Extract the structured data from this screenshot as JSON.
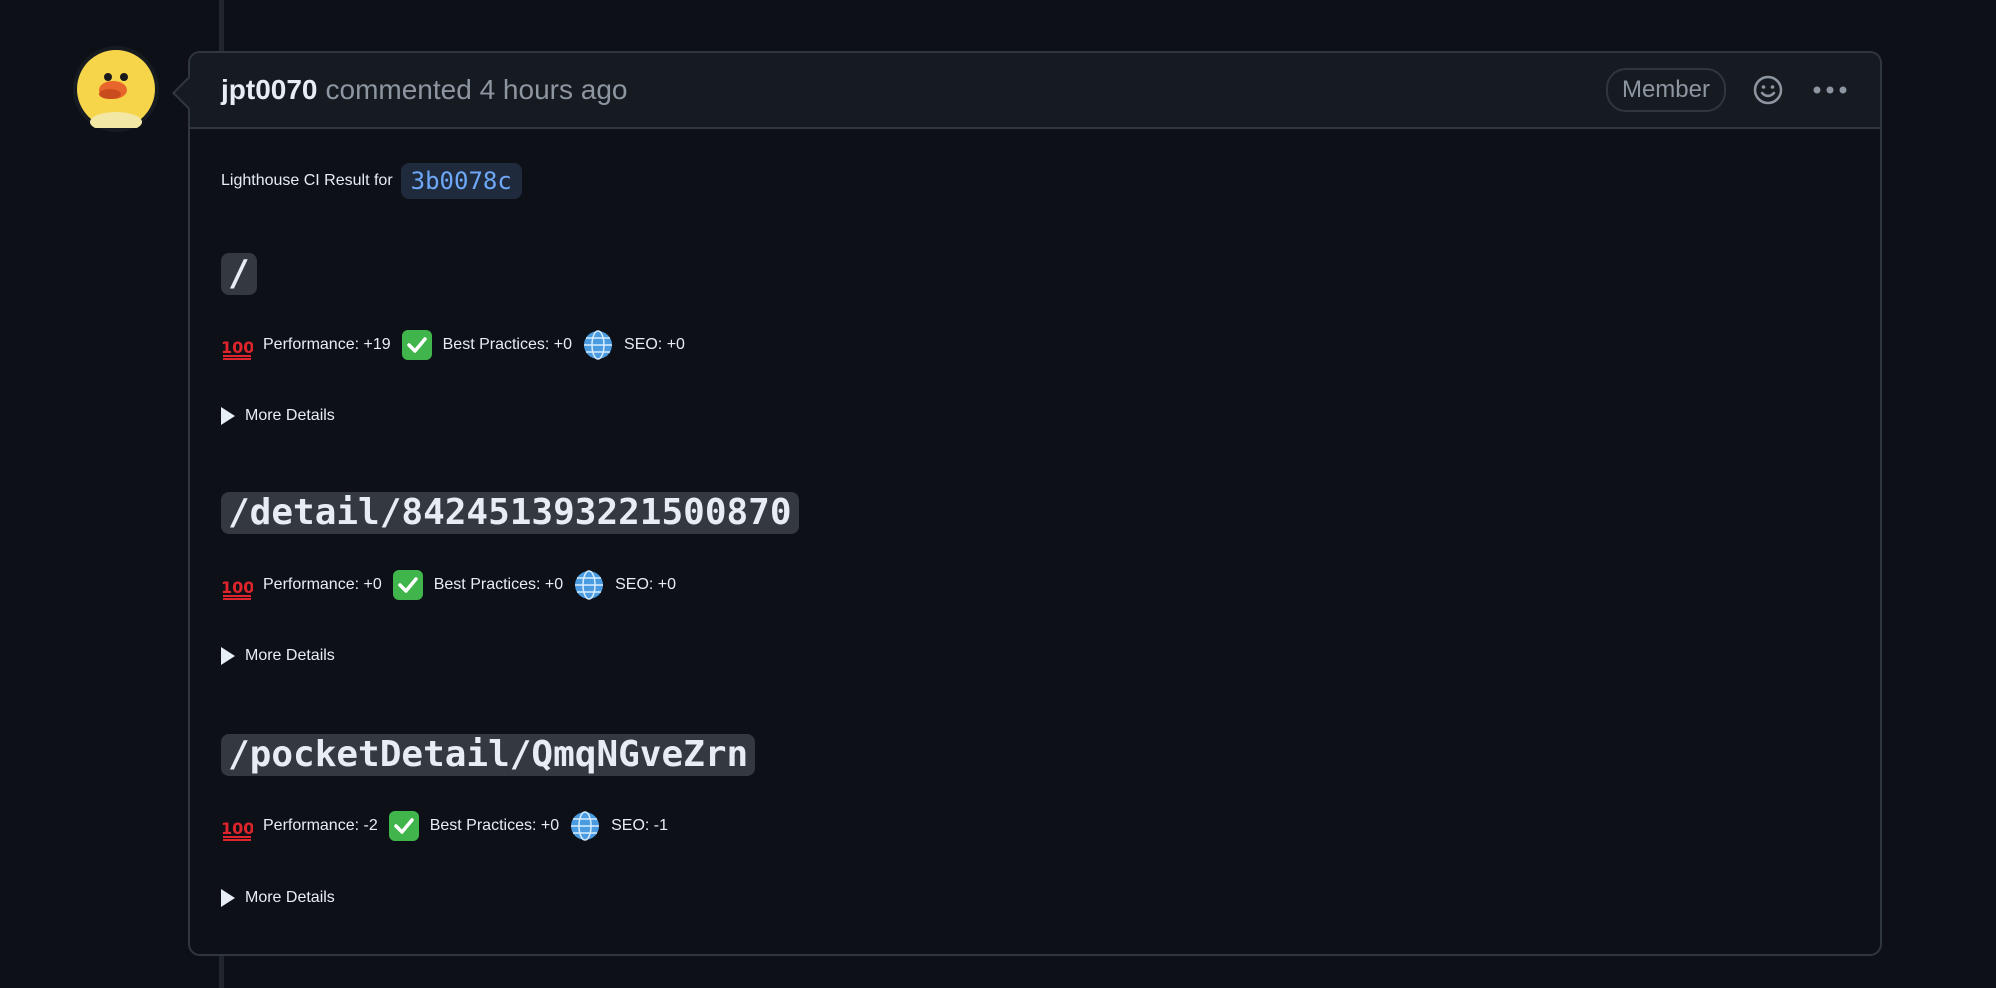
{
  "comment": {
    "author": "jpt0070",
    "meta": "commented 4 hours ago",
    "badge": "Member",
    "intro_text": "Lighthouse CI Result for",
    "commit": "3b0078c"
  },
  "routes": [
    {
      "path": "/",
      "performance": "Performance: +19",
      "best_practices": "Best Practices: +0",
      "seo": "SEO: +0",
      "details_label": "More Details"
    },
    {
      "path": "/detail/842451393221500870",
      "performance": "Performance: +0",
      "best_practices": "Best Practices: +0",
      "seo": "SEO: +0",
      "details_label": "More Details"
    },
    {
      "path": "/pocketDetail/QmqNGveZrn",
      "performance": "Performance: -2",
      "best_practices": "Best Practices: +0",
      "seo": "SEO: -1",
      "details_label": "More Details"
    }
  ],
  "icons": {
    "performance": "hundred-points-icon",
    "best_practices": "check-mark-button-icon",
    "seo": "globe-icon",
    "reaction": "smiley-icon",
    "menu": "kebab-horizontal-icon",
    "details": "triangle-right-icon"
  },
  "colors": {
    "background": "#0d1117",
    "header_bg": "#161b22",
    "border": "#30363d",
    "text": "#e6edf3",
    "muted": "#8d96a0",
    "link": "#6fa8f7"
  }
}
